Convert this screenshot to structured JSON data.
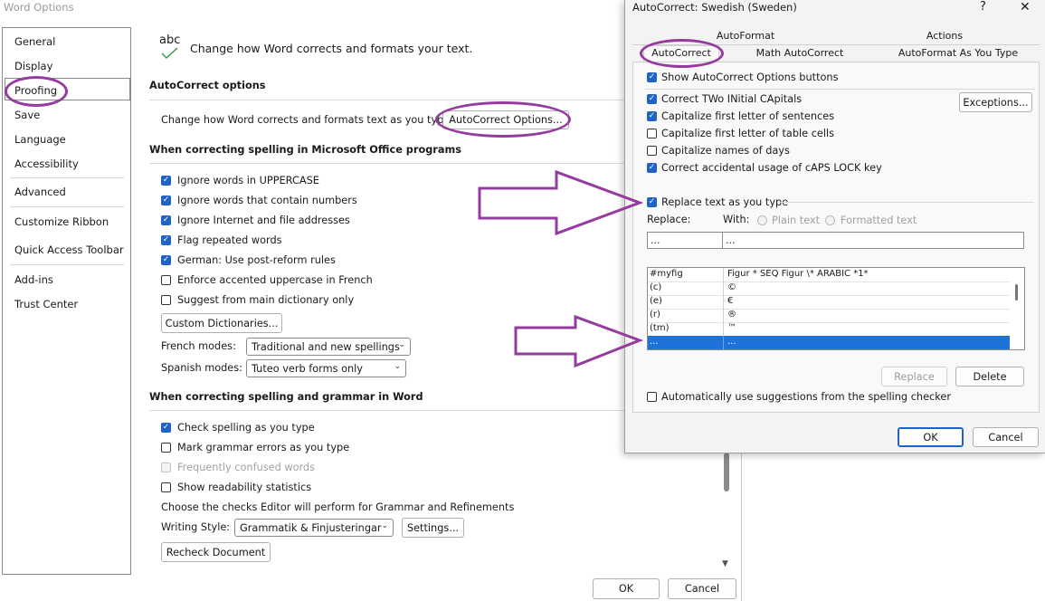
{
  "word_options": {
    "title": "Word Options",
    "nav": [
      "General",
      "Display",
      "Proofing",
      "Save",
      "Language",
      "Accessibility",
      "Advanced",
      "Customize Ribbon",
      "Quick Access Toolbar",
      "Add-ins",
      "Trust Center"
    ],
    "header_icon_text": "abc",
    "header_text": "Change how Word corrects and formats your text.",
    "autocorrect_options_title": "AutoCorrect options",
    "autocorrect_desc": "Change how Word corrects and formats text as you type:",
    "autocorrect_btn": "AutoCorrect Options...",
    "spelling_office_title": "When correcting spelling in Microsoft Office programs",
    "office_checks": [
      {
        "label": "Ignore words in UPPERCASE",
        "checked": true
      },
      {
        "label": "Ignore words that contain numbers",
        "checked": true
      },
      {
        "label": "Ignore Internet and file addresses",
        "checked": true
      },
      {
        "label": "Flag repeated words",
        "checked": true
      },
      {
        "label": "German: Use post-reform rules",
        "checked": true
      },
      {
        "label": "Enforce accented uppercase in French",
        "checked": false
      },
      {
        "label": "Suggest from main dictionary only",
        "checked": false
      }
    ],
    "custom_dict_btn": "Custom Dictionaries...",
    "french_label": "French modes:",
    "french_value": "Traditional and new spellings",
    "spanish_label": "Spanish modes:",
    "spanish_value": "Tuteo verb forms only",
    "spelling_word_title": "When correcting spelling and grammar in Word",
    "word_checks": [
      {
        "label": "Check spelling as you type",
        "checked": true,
        "disabled": false
      },
      {
        "label": "Mark grammar errors as you type",
        "checked": false,
        "disabled": false
      },
      {
        "label": "Frequently confused words",
        "checked": false,
        "disabled": true
      },
      {
        "label": "Show readability statistics",
        "checked": false,
        "disabled": false
      }
    ],
    "editor_desc": "Choose the checks Editor will perform for Grammar and Refinements",
    "writing_style_label": "Writing Style:",
    "writing_style_value": "Grammatik & Finjusteringar",
    "settings_btn": "Settings...",
    "recheck_btn": "Recheck Document",
    "ok_btn": "OK",
    "cancel_btn": "Cancel"
  },
  "autocorrect": {
    "title": "AutoCorrect: Swedish (Sweden)",
    "help_icon": "?",
    "close_icon": "✕",
    "tabs_top": [
      "AutoFormat",
      "Actions"
    ],
    "tabs_bottom": [
      "AutoCorrect",
      "Math AutoCorrect",
      "AutoFormat As You Type"
    ],
    "show_buttons": "Show AutoCorrect Options buttons",
    "checks": [
      {
        "label": "Correct TWo INitial CApitals",
        "checked": true
      },
      {
        "label": "Capitalize first letter of sentences",
        "checked": true
      },
      {
        "label": "Capitalize first letter of table cells",
        "checked": false
      },
      {
        "label": "Capitalize names of days",
        "checked": false
      },
      {
        "label": "Correct accidental usage of cAPS LOCK key",
        "checked": true
      }
    ],
    "exceptions_btn": "Exceptions...",
    "replace_text": "Replace text as you type",
    "replace_label": "Replace:",
    "with_label": "With:",
    "plain_text": "Plain text",
    "formatted_text": "Formatted text",
    "replace_value": "...",
    "with_value": "...",
    "rows": [
      {
        "replace": "#myfig",
        "with": "Figur * SEQ Figur \\* ARABIC *1*"
      },
      {
        "replace": "(c)",
        "with": "©"
      },
      {
        "replace": "(e)",
        "with": "€"
      },
      {
        "replace": "(r)",
        "with": "®"
      },
      {
        "replace": "(tm)",
        "with": "™"
      },
      {
        "replace": "...",
        "with": "..."
      }
    ],
    "replace_btn": "Replace",
    "delete_btn": "Delete",
    "auto_suggest": "Automatically use suggestions from the spelling checker",
    "ok_btn": "OK",
    "cancel_btn": "Cancel"
  },
  "colors": {
    "accent": "#1f63c5",
    "annotation": "#953a9f",
    "selection": "#1e73d8"
  }
}
